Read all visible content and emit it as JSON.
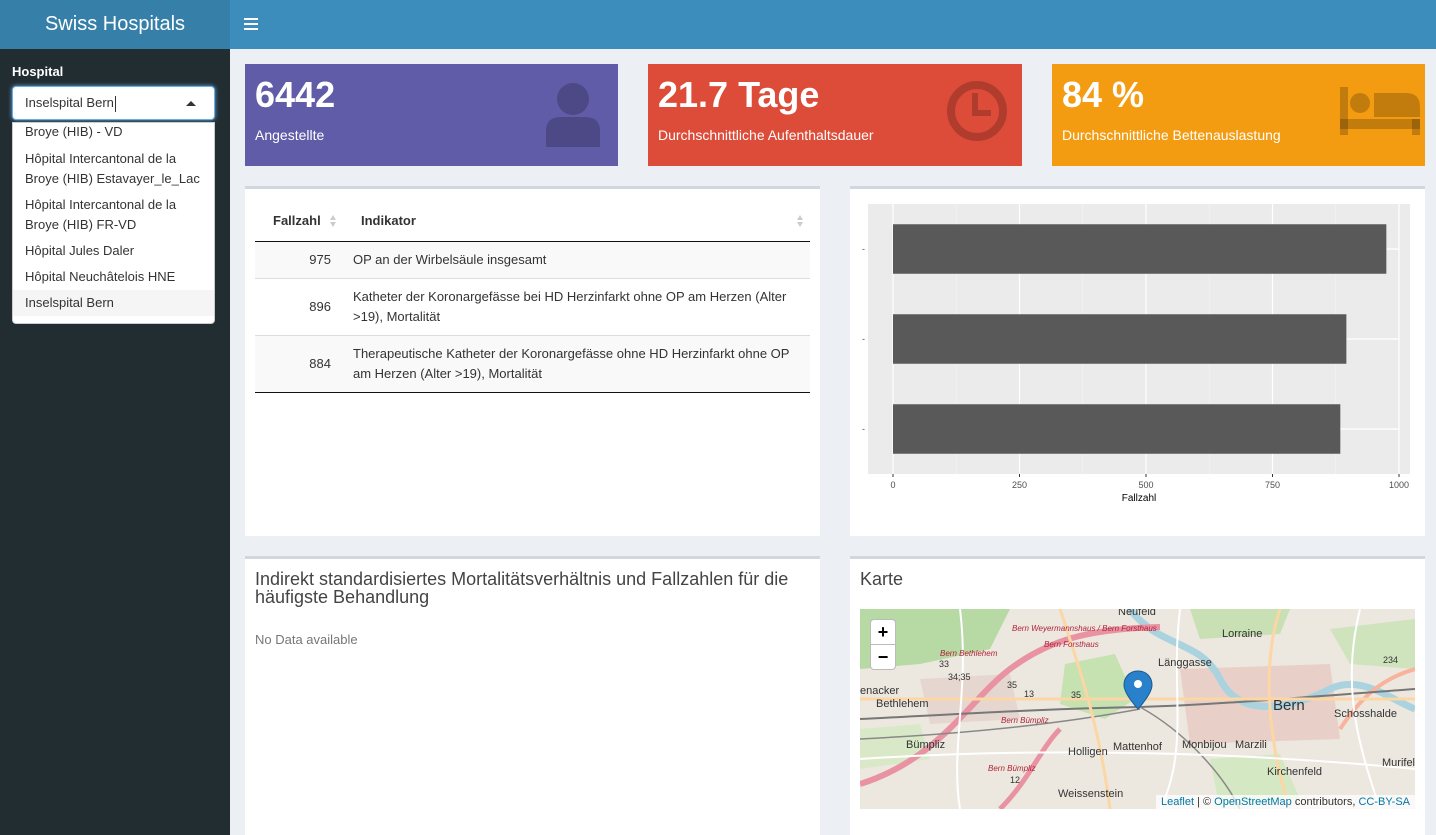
{
  "app": {
    "title": "Swiss Hospitals"
  },
  "sidebar": {
    "hospital_label": "Hospital",
    "hospital_value": "Inselspital Bern",
    "options": [
      "Broye (HIB) - VD",
      "Hôpital Intercantonal de la Broye (HIB) Estavayer_le_Lac",
      "Hôpital Intercantonal de la Broye (HIB) FR-VD",
      "Hôpital Jules Daler",
      "Hôpital Neuchâtelois HNE",
      "Inselspital Bern",
      "Inselspital Bern"
    ]
  },
  "infoboxes": [
    {
      "value": "6442",
      "label": "Angestellte",
      "color": "#605ca8",
      "icon": "user-icon"
    },
    {
      "value": "21.7 Tage",
      "label": "Durchschnittliche Aufenthaltsdauer",
      "color": "#dd4b39",
      "icon": "clock-icon"
    },
    {
      "value": "84 %",
      "label": "Durchschnittliche Bettenauslastung",
      "color": "#f39c12",
      "icon": "bed-icon"
    }
  ],
  "table": {
    "headers": [
      "Fallzahl",
      "Indikator"
    ],
    "rows": [
      {
        "fallzahl": "975",
        "indikator": "OP an der Wirbelsäule insgesamt"
      },
      {
        "fallzahl": "896",
        "indikator": "Katheter der Koronargefässe bei HD Herzinfarkt ohne OP am Herzen (Alter >19), Mortalität"
      },
      {
        "fallzahl": "884",
        "indikator": "Therapeutische Katheter der Koronargefässe ohne HD Herzinfarkt ohne OP am Herzen (Alter >19), Mortalität"
      }
    ]
  },
  "chart_data": {
    "type": "bar",
    "orientation": "horizontal",
    "categories": [
      "-",
      "-",
      "-"
    ],
    "values": [
      975,
      896,
      884
    ],
    "xlabel": "Fallzahl",
    "ylabel": "",
    "xlim": [
      0,
      1000
    ],
    "xticks": [
      0,
      250,
      500,
      750,
      1000
    ],
    "grid": true,
    "bar_color": "#595959",
    "panel_color": "#ebebeb"
  },
  "smr": {
    "title": "Indirekt standardisiertes Mortalitätsverhältnis und Fallzahlen für die häufigste Behandlung",
    "empty_text": "No Data available"
  },
  "map": {
    "title": "Karte",
    "zoom_in": "+",
    "zoom_out": "−",
    "labels": [
      "Neufeld",
      "Lorraine",
      "Länggasse",
      "Bern",
      "Schosshalde",
      "Bethlehem",
      "Bümpliz",
      "Holligen",
      "Mattenhof",
      "Monbijou",
      "Marzili",
      "Kirchenfeld",
      "Weissenstein",
      "Murifel",
      "enacker",
      "Bern Weyermannshaus / Bern Forsthaus",
      "Bern Forsthaus",
      "Bern Bethlehem",
      "Bern Bümpliz",
      "Bern Bümpliz",
      "33",
      "34;35",
      "35",
      "13",
      "12",
      "234",
      "35"
    ],
    "attrib_leaflet": "Leaflet",
    "attrib_sep": " | © ",
    "attrib_osm": "OpenStreetMap",
    "attrib_contrib": " contributors, ",
    "attrib_license": "CC-BY-SA"
  }
}
